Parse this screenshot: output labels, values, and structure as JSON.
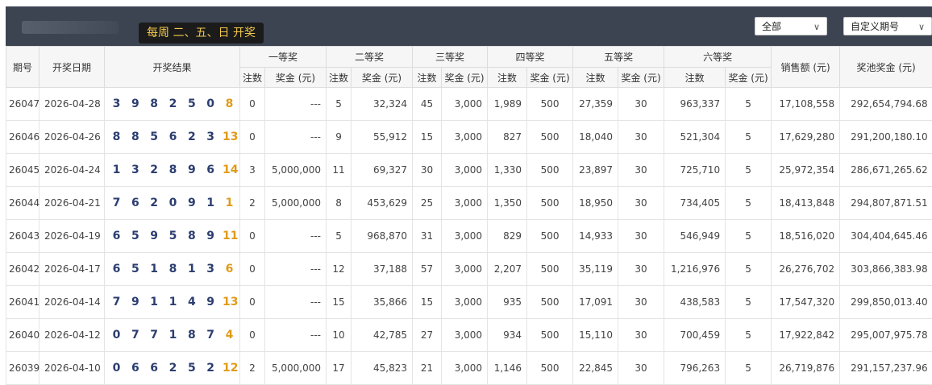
{
  "header": {
    "schedule": "每周 二、五、日 开奖",
    "filter_select": "全部",
    "period_select": "自定义期号"
  },
  "columns": {
    "period": "期号",
    "date": "开奖日期",
    "result": "开奖结果",
    "prize1": "一等奖",
    "prize2": "二等奖",
    "prize3": "三等奖",
    "prize4": "四等奖",
    "prize5": "五等奖",
    "prize6": "六等奖",
    "sales": "销售额 (元)",
    "pool": "奖池奖金 (元)",
    "count": "注数",
    "amount": "奖金 (元)"
  },
  "rows": [
    {
      "period": "26047",
      "date": "2026-04-28",
      "balls": [
        "3",
        "9",
        "8",
        "2",
        "5",
        "0"
      ],
      "bonus": "8",
      "p1c": "0",
      "p1a": "---",
      "p2c": "5",
      "p2a": "32,324",
      "p3c": "45",
      "p3a": "3,000",
      "p4c": "1,989",
      "p4a": "500",
      "p5c": "27,359",
      "p5a": "30",
      "p6c": "963,337",
      "p6a": "5",
      "sales": "17,108,558",
      "pool": "292,654,794.68"
    },
    {
      "period": "26046",
      "date": "2026-04-26",
      "balls": [
        "8",
        "8",
        "5",
        "6",
        "2",
        "3"
      ],
      "bonus": "13",
      "p1c": "0",
      "p1a": "---",
      "p2c": "9",
      "p2a": "55,912",
      "p3c": "15",
      "p3a": "3,000",
      "p4c": "827",
      "p4a": "500",
      "p5c": "18,040",
      "p5a": "30",
      "p6c": "521,304",
      "p6a": "5",
      "sales": "17,629,280",
      "pool": "291,200,180.10"
    },
    {
      "period": "26045",
      "date": "2026-04-24",
      "balls": [
        "1",
        "3",
        "2",
        "8",
        "9",
        "6"
      ],
      "bonus": "14",
      "p1c": "3",
      "p1a": "5,000,000",
      "p2c": "11",
      "p2a": "69,327",
      "p3c": "30",
      "p3a": "3,000",
      "p4c": "1,330",
      "p4a": "500",
      "p5c": "23,897",
      "p5a": "30",
      "p6c": "725,710",
      "p6a": "5",
      "sales": "25,972,354",
      "pool": "286,671,265.62"
    },
    {
      "period": "26044",
      "date": "2026-04-21",
      "balls": [
        "7",
        "6",
        "2",
        "0",
        "9",
        "1"
      ],
      "bonus": "1",
      "p1c": "2",
      "p1a": "5,000,000",
      "p2c": "8",
      "p2a": "453,629",
      "p3c": "25",
      "p3a": "3,000",
      "p4c": "1,350",
      "p4a": "500",
      "p5c": "18,950",
      "p5a": "30",
      "p6c": "734,405",
      "p6a": "5",
      "sales": "18,413,848",
      "pool": "294,807,871.51"
    },
    {
      "period": "26043",
      "date": "2026-04-19",
      "balls": [
        "6",
        "5",
        "9",
        "5",
        "8",
        "9"
      ],
      "bonus": "11",
      "p1c": "0",
      "p1a": "---",
      "p2c": "5",
      "p2a": "968,870",
      "p3c": "31",
      "p3a": "3,000",
      "p4c": "829",
      "p4a": "500",
      "p5c": "14,933",
      "p5a": "30",
      "p6c": "546,949",
      "p6a": "5",
      "sales": "18,516,020",
      "pool": "304,404,645.46"
    },
    {
      "period": "26042",
      "date": "2026-04-17",
      "balls": [
        "6",
        "5",
        "1",
        "8",
        "1",
        "3"
      ],
      "bonus": "6",
      "p1c": "0",
      "p1a": "---",
      "p2c": "12",
      "p2a": "37,188",
      "p3c": "57",
      "p3a": "3,000",
      "p4c": "2,207",
      "p4a": "500",
      "p5c": "35,119",
      "p5a": "30",
      "p6c": "1,216,976",
      "p6a": "5",
      "sales": "26,276,702",
      "pool": "303,866,383.98"
    },
    {
      "period": "26041",
      "date": "2026-04-14",
      "balls": [
        "7",
        "9",
        "1",
        "1",
        "4",
        "9"
      ],
      "bonus": "13",
      "p1c": "0",
      "p1a": "---",
      "p2c": "15",
      "p2a": "35,866",
      "p3c": "15",
      "p3a": "3,000",
      "p4c": "935",
      "p4a": "500",
      "p5c": "17,091",
      "p5a": "30",
      "p6c": "438,583",
      "p6a": "5",
      "sales": "17,547,320",
      "pool": "299,850,013.40"
    },
    {
      "period": "26040",
      "date": "2026-04-12",
      "balls": [
        "0",
        "7",
        "7",
        "1",
        "8",
        "7"
      ],
      "bonus": "4",
      "p1c": "0",
      "p1a": "---",
      "p2c": "10",
      "p2a": "42,785",
      "p3c": "27",
      "p3a": "3,000",
      "p4c": "934",
      "p4a": "500",
      "p5c": "15,110",
      "p5a": "30",
      "p6c": "700,459",
      "p6a": "5",
      "sales": "17,922,842",
      "pool": "295,007,975.78"
    },
    {
      "period": "26039",
      "date": "2026-04-10",
      "balls": [
        "0",
        "6",
        "6",
        "2",
        "5",
        "2"
      ],
      "bonus": "12",
      "p1c": "2",
      "p1a": "5,000,000",
      "p2c": "17",
      "p2a": "45,823",
      "p3c": "21",
      "p3a": "3,000",
      "p4c": "1,146",
      "p4a": "500",
      "p5c": "22,845",
      "p5a": "30",
      "p6c": "796,263",
      "p6a": "5",
      "sales": "26,719,876",
      "pool": "291,157,237.96"
    }
  ]
}
